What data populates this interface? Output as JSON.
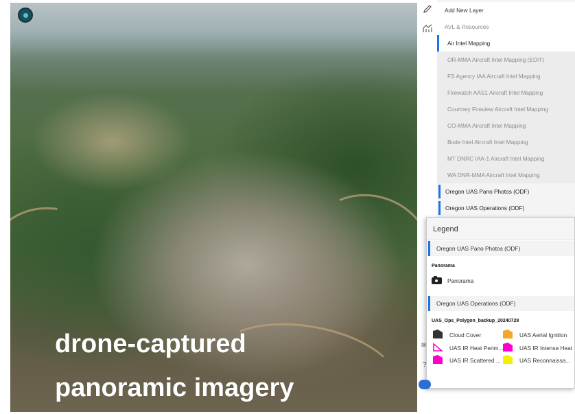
{
  "overlay": {
    "line1": "drone-captured",
    "line2": "panoramic imagery"
  },
  "toolbar": {
    "icons": [
      "pencil-icon",
      "chart-icon"
    ]
  },
  "layers": {
    "add_label": "Add New Layer",
    "avl_label": "AVL & Resources",
    "air_intel_label": "Air Intel Mapping",
    "air_intel_children": [
      "OR-MMA Aircraft Intel Mapping (EDIT)",
      "FS Agency IAA Aircraft Intel Mapping",
      "Firewatch AAS1 Aircraft Intel Mapping",
      "Courtney Fireview Aircraft Intel Mapping",
      "CO-MMA Aircraft Intel Mapping",
      "Bode Intel Aircraft Intel Mapping",
      "MT DNRC IAA-1 Aircraft Intel Mapping",
      "WA DNR-MMA Aircraft Intel Mapping"
    ],
    "uas_pano": "Oregon UAS Pano Photos (ODF)",
    "uas_ops": "Oregon UAS Operations (ODF)"
  },
  "legend": {
    "title": "Legend",
    "pano_layer": "Oregon UAS Pano Photos (ODF)",
    "pano_group": "Panorama",
    "pano_item": "Panorama",
    "ops_layer": "Oregon UAS Operations (ODF)",
    "ops_group": "UAS_Ops_Polygon_backup_20240728",
    "items": [
      {
        "label": "Cloud Cover",
        "color": "#333333"
      },
      {
        "label": "UAS Aerial Ignition",
        "color": "#f5a623"
      },
      {
        "label": "UAS IR Heat Perim...",
        "color": "#ff00cc"
      },
      {
        "label": "UAS IR Intense Heat",
        "color": "#ff00cc"
      },
      {
        "label": "UAS IR Scattered ...",
        "color": "#ff00cc"
      },
      {
        "label": "UAS Reconnaissa...",
        "color": "#f5ef00"
      }
    ]
  }
}
